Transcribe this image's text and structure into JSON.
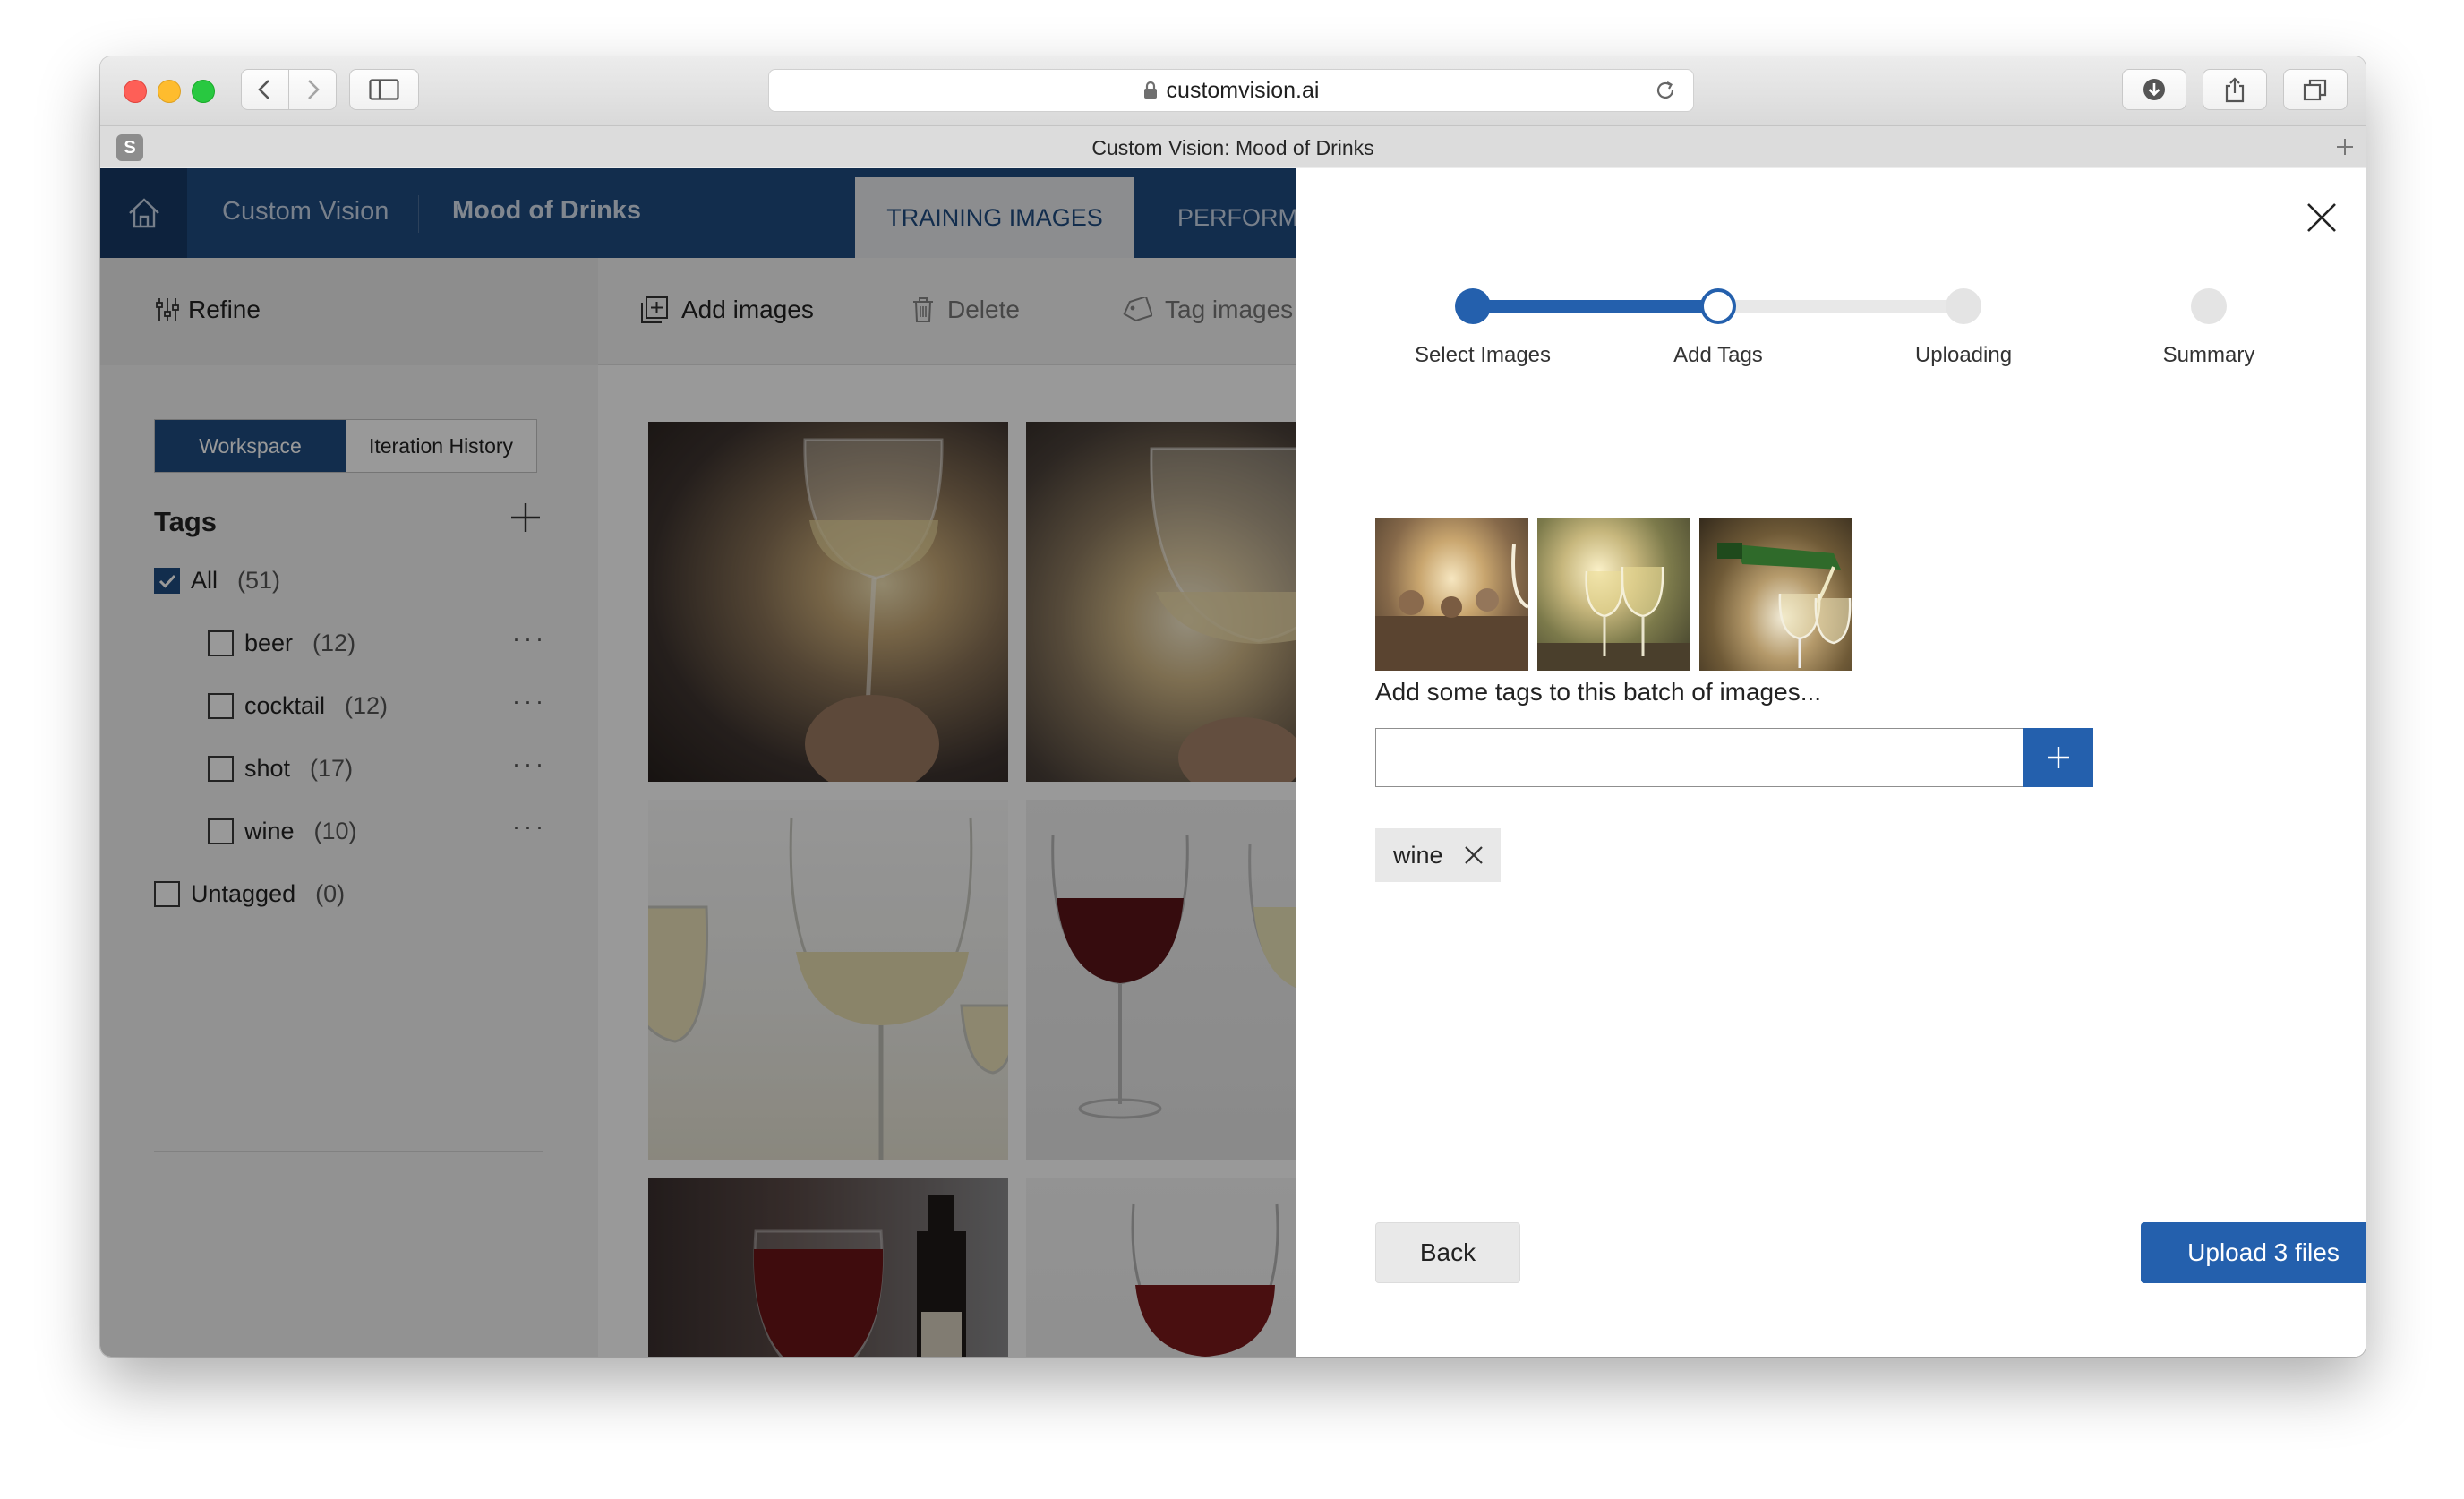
{
  "browser": {
    "url": "customvision.ai",
    "tab_title": "Custom Vision: Mood of Drinks",
    "favicon_letter": "S",
    "icons": [
      "back-icon",
      "forward-icon",
      "sidebar-icon",
      "lock-icon",
      "reload-icon",
      "download-icon",
      "share-icon",
      "tabs-overview-icon",
      "new-tab-icon"
    ]
  },
  "app": {
    "brand": "Custom Vision",
    "project": "Mood of Drinks",
    "tabs": [
      {
        "label": "TRAINING IMAGES",
        "active": true
      },
      {
        "label": "PERFORMA",
        "active": false
      }
    ],
    "toolbar": {
      "refine": "Refine",
      "add_images": "Add images",
      "delete": "Delete",
      "tag_images": "Tag images"
    },
    "segments": {
      "workspace": "Workspace",
      "iteration_history": "Iteration History"
    },
    "tags_heading": "Tags",
    "tags": [
      {
        "label": "All",
        "count": "(51)",
        "checked": true
      },
      {
        "label": "beer",
        "count": "(12)",
        "checked": false,
        "more": "···"
      },
      {
        "label": "cocktail",
        "count": "(12)",
        "checked": false,
        "more": "···"
      },
      {
        "label": "shot",
        "count": "(17)",
        "checked": false,
        "more": "···"
      },
      {
        "label": "wine",
        "count": "(10)",
        "checked": false,
        "more": "···"
      },
      {
        "label": "Untagged",
        "count": "(0)",
        "checked": false
      }
    ]
  },
  "dialog": {
    "steps": [
      {
        "label": "Select Images",
        "state": "done"
      },
      {
        "label": "Add Tags",
        "state": "active"
      },
      {
        "label": "Uploading",
        "state": "todo"
      },
      {
        "label": "Summary",
        "state": "todo"
      }
    ],
    "batch_label": "Add some tags to this batch of images...",
    "tag_input_value": "",
    "chips": [
      "wine"
    ],
    "back_label": "Back",
    "upload_label": "Upload 3 files"
  },
  "colors": {
    "accent": "#2460ad",
    "header": "#1f4b80"
  }
}
